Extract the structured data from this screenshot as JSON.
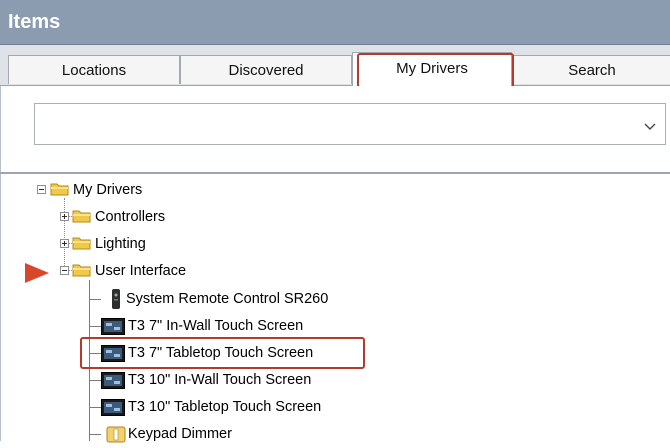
{
  "panel": {
    "title": "Items"
  },
  "tabs": [
    {
      "label": "Locations",
      "active": false
    },
    {
      "label": "Discovered",
      "active": false
    },
    {
      "label": "My Drivers",
      "active": true
    },
    {
      "label": "Search",
      "active": false
    }
  ],
  "filter": {
    "value": "",
    "icon": "chevron-down-icon"
  },
  "tree": {
    "root": {
      "label": "My Drivers",
      "icon": "folder-icon",
      "expanded": true
    },
    "folders": [
      {
        "label": "Controllers",
        "icon": "folder-icon",
        "expanded": false
      },
      {
        "label": "Lighting",
        "icon": "folder-icon",
        "expanded": false
      },
      {
        "label": "User Interface",
        "icon": "folder-icon",
        "expanded": true
      }
    ],
    "user_interface_items": [
      {
        "label": "System Remote Control SR260",
        "icon": "remote-icon"
      },
      {
        "label": "T3 7\" In-Wall Touch Screen",
        "icon": "touchscreen-icon"
      },
      {
        "label": "T3 7\" Tabletop Touch Screen",
        "icon": "touchscreen-icon",
        "highlighted": true
      },
      {
        "label": "T3 10\" In-Wall Touch Screen",
        "icon": "touchscreen-icon"
      },
      {
        "label": "T3 10\" Tabletop Touch Screen",
        "icon": "touchscreen-icon"
      },
      {
        "label": "Keypad Dimmer",
        "icon": "keypad-dimmer-icon"
      }
    ]
  },
  "annotation_colors": {
    "highlight": "#b43a2c",
    "arrow": "#d9472b"
  }
}
